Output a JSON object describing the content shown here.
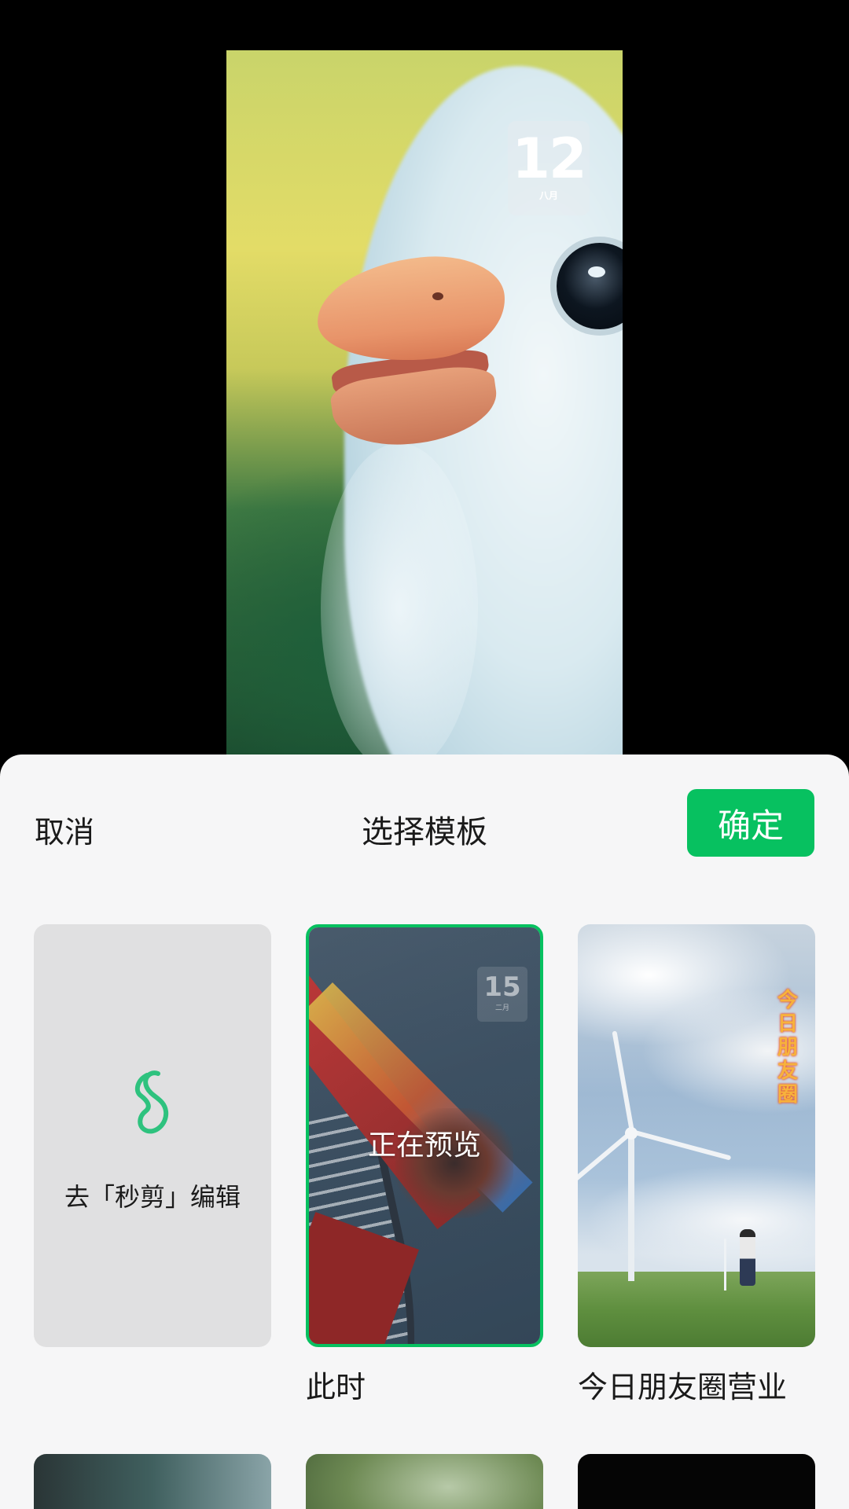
{
  "preview": {
    "date_widget": {
      "day": "12",
      "month": "八月"
    }
  },
  "sheet": {
    "cancel_label": "取消",
    "title": "选择模板",
    "confirm_label": "确定"
  },
  "templates": [
    {
      "label": "去「秒剪」编辑",
      "icon": "miaojian-logo-icon"
    },
    {
      "caption": "此时",
      "overlay": "正在预览",
      "selected": true,
      "date": {
        "day": "15",
        "month": "二月"
      }
    },
    {
      "caption": "今日朋友圈营业",
      "vertical_title": "今日朋友圈"
    }
  ],
  "colors": {
    "accent": "#07c160",
    "sheet_bg": "#f6f6f7",
    "tile_bg": "#e0e0e1"
  }
}
